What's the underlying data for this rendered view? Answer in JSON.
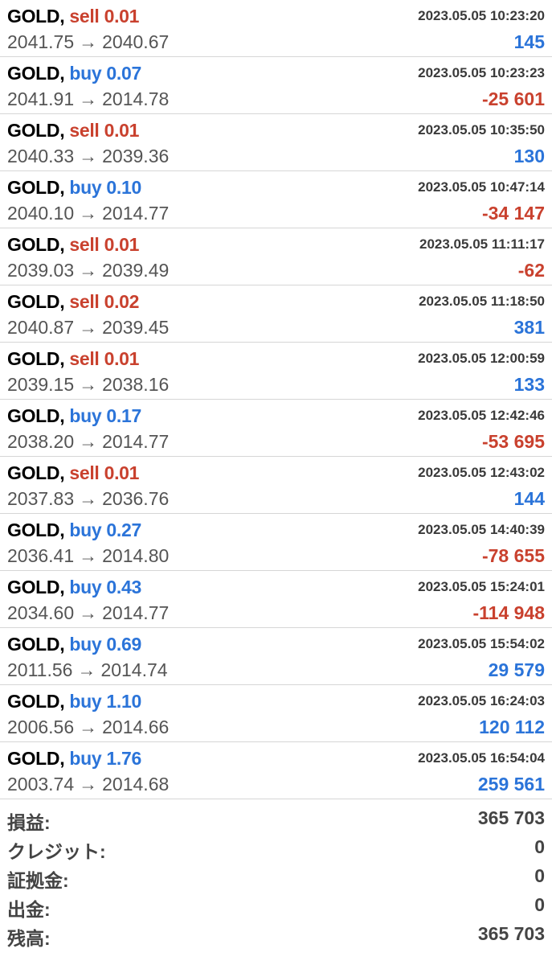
{
  "deals": [
    {
      "symbol": "GOLD,",
      "side": "sell",
      "volume": "sell 0.01",
      "time": "2023.05.05 10:23:20",
      "open": "2041.75",
      "close": "2040.67",
      "profit": "145",
      "profit_sign": "pos"
    },
    {
      "symbol": "GOLD,",
      "side": "buy",
      "volume": "buy 0.07",
      "time": "2023.05.05 10:23:23",
      "open": "2041.91",
      "close": "2014.78",
      "profit": "-25 601",
      "profit_sign": "neg"
    },
    {
      "symbol": "GOLD,",
      "side": "sell",
      "volume": "sell 0.01",
      "time": "2023.05.05 10:35:50",
      "open": "2040.33",
      "close": "2039.36",
      "profit": "130",
      "profit_sign": "pos"
    },
    {
      "symbol": "GOLD,",
      "side": "buy",
      "volume": "buy 0.10",
      "time": "2023.05.05 10:47:14",
      "open": "2040.10",
      "close": "2014.77",
      "profit": "-34 147",
      "profit_sign": "neg"
    },
    {
      "symbol": "GOLD,",
      "side": "sell",
      "volume": "sell 0.01",
      "time": "2023.05.05 11:11:17",
      "open": "2039.03",
      "close": "2039.49",
      "profit": "-62",
      "profit_sign": "neg"
    },
    {
      "symbol": "GOLD,",
      "side": "sell",
      "volume": "sell 0.02",
      "time": "2023.05.05 11:18:50",
      "open": "2040.87",
      "close": "2039.45",
      "profit": "381",
      "profit_sign": "pos"
    },
    {
      "symbol": "GOLD,",
      "side": "sell",
      "volume": "sell 0.01",
      "time": "2023.05.05 12:00:59",
      "open": "2039.15",
      "close": "2038.16",
      "profit": "133",
      "profit_sign": "pos"
    },
    {
      "symbol": "GOLD,",
      "side": "buy",
      "volume": "buy 0.17",
      "time": "2023.05.05 12:42:46",
      "open": "2038.20",
      "close": "2014.77",
      "profit": "-53 695",
      "profit_sign": "neg"
    },
    {
      "symbol": "GOLD,",
      "side": "sell",
      "volume": "sell 0.01",
      "time": "2023.05.05 12:43:02",
      "open": "2037.83",
      "close": "2036.76",
      "profit": "144",
      "profit_sign": "pos"
    },
    {
      "symbol": "GOLD,",
      "side": "buy",
      "volume": "buy 0.27",
      "time": "2023.05.05 14:40:39",
      "open": "2036.41",
      "close": "2014.80",
      "profit": "-78 655",
      "profit_sign": "neg"
    },
    {
      "symbol": "GOLD,",
      "side": "buy",
      "volume": "buy 0.43",
      "time": "2023.05.05 15:24:01",
      "open": "2034.60",
      "close": "2014.77",
      "profit": "-114 948",
      "profit_sign": "neg"
    },
    {
      "symbol": "GOLD,",
      "side": "buy",
      "volume": "buy 0.69",
      "time": "2023.05.05 15:54:02",
      "open": "2011.56",
      "close": "2014.74",
      "profit": "29 579",
      "profit_sign": "pos"
    },
    {
      "symbol": "GOLD,",
      "side": "buy",
      "volume": "buy 1.10",
      "time": "2023.05.05 16:24:03",
      "open": "2006.56",
      "close": "2014.66",
      "profit": "120 112",
      "profit_sign": "pos"
    },
    {
      "symbol": "GOLD,",
      "side": "buy",
      "volume": "buy 1.76",
      "time": "2023.05.05 16:54:04",
      "open": "2003.74",
      "close": "2014.68",
      "profit": "259 561",
      "profit_sign": "pos"
    }
  ],
  "arrow": "→",
  "summary": {
    "profit_label": "損益:",
    "profit_value": "365 703",
    "credit_label": "クレジット:",
    "credit_value": "0",
    "deposit_label": "証拠金:",
    "deposit_value": "0",
    "withdrawal_label": "出金:",
    "withdrawal_value": "0",
    "balance_label": "残高:",
    "balance_value": "365 703"
  },
  "colors": {
    "sell": "#c9412e",
    "buy": "#2b74d9",
    "profit_positive": "#2b74d9",
    "profit_negative": "#c9412e"
  }
}
